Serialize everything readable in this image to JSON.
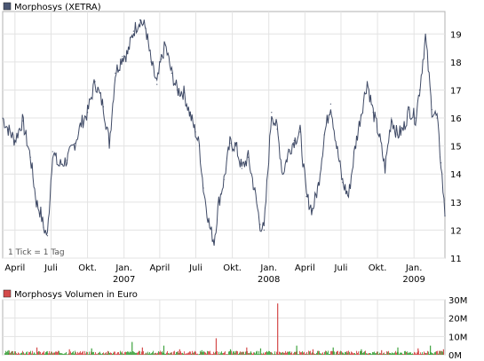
{
  "chart_data": [
    {
      "type": "line",
      "title": "Morphosys (XETRA)",
      "legend_color": "#4a5673",
      "line_color": "#3f4a66",
      "annotation": "1 Tick = 1 Tag",
      "ylim": [
        11,
        19.8
      ],
      "yticks": [
        11,
        12,
        13,
        14,
        15,
        16,
        17,
        18,
        19
      ],
      "grid": true,
      "x_tick_labels": [
        {
          "label": "April",
          "year": ""
        },
        {
          "label": "Juli",
          "year": ""
        },
        {
          "label": "Okt.",
          "year": ""
        },
        {
          "label": "Jan.",
          "year": "2007"
        },
        {
          "label": "April",
          "year": ""
        },
        {
          "label": "Juli",
          "year": ""
        },
        {
          "label": "Okt.",
          "year": ""
        },
        {
          "label": "Jan.",
          "year": "2008"
        },
        {
          "label": "April",
          "year": ""
        },
        {
          "label": "Juli",
          "year": ""
        },
        {
          "label": "Okt.",
          "year": ""
        },
        {
          "label": "Jan.",
          "year": "2009"
        }
      ],
      "x_range": [
        "2006-03-01",
        "2009-03-20"
      ],
      "x_ticks": [
        "2006-04-01",
        "2006-07-01",
        "2006-10-01",
        "2007-01-01",
        "2007-04-01",
        "2007-07-01",
        "2007-10-01",
        "2008-01-01",
        "2008-04-01",
        "2008-07-01",
        "2008-10-01",
        "2009-01-01"
      ],
      "series": [
        {
          "name": "Morphosys (XETRA)",
          "x": [
            "2006-03-01",
            "2006-03-15",
            "2006-04-01",
            "2006-04-20",
            "2006-05-10",
            "2006-05-25",
            "2006-06-05",
            "2006-06-12",
            "2006-06-22",
            "2006-07-05",
            "2006-07-20",
            "2006-08-10",
            "2006-08-30",
            "2006-09-15",
            "2006-10-01",
            "2006-10-20",
            "2006-11-10",
            "2006-11-25",
            "2006-12-10",
            "2006-12-28",
            "2007-01-10",
            "2007-01-25",
            "2007-02-10",
            "2007-02-25",
            "2007-03-10",
            "2007-03-25",
            "2007-04-05",
            "2007-04-15",
            "2007-05-01",
            "2007-05-15",
            "2007-06-01",
            "2007-06-15",
            "2007-06-30",
            "2007-07-10",
            "2007-07-20",
            "2007-08-05",
            "2007-08-16",
            "2007-08-28",
            "2007-09-10",
            "2007-09-25",
            "2007-10-10",
            "2007-10-25",
            "2007-11-10",
            "2007-11-25",
            "2007-12-10",
            "2007-12-20",
            "2008-01-08",
            "2008-01-22",
            "2008-02-05",
            "2008-02-20",
            "2008-03-05",
            "2008-03-20",
            "2008-04-05",
            "2008-04-20",
            "2008-05-05",
            "2008-05-20",
            "2008-06-05",
            "2008-06-20",
            "2008-07-05",
            "2008-07-20",
            "2008-08-05",
            "2008-08-20",
            "2008-09-05",
            "2008-09-20",
            "2008-10-05",
            "2008-10-20",
            "2008-11-05",
            "2008-11-20",
            "2008-12-05",
            "2008-12-20",
            "2009-01-05",
            "2009-01-15",
            "2009-01-30",
            "2009-02-15",
            "2009-02-28",
            "2009-03-10",
            "2009-03-20"
          ],
          "values": [
            16.0,
            15.6,
            15.2,
            15.9,
            14.6,
            13.0,
            12.6,
            12.1,
            11.8,
            14.8,
            14.3,
            14.5,
            15.1,
            15.8,
            16.2,
            17.3,
            16.4,
            15.1,
            17.6,
            18.2,
            18.3,
            19.1,
            19.5,
            19.2,
            18.0,
            17.2,
            18.1,
            18.6,
            17.6,
            17.0,
            16.9,
            16.2,
            15.5,
            15.0,
            13.5,
            12.1,
            11.6,
            13.0,
            13.8,
            15.1,
            15.0,
            14.2,
            14.6,
            13.5,
            12.2,
            12.0,
            16.2,
            15.6,
            14.0,
            14.8,
            15.2,
            15.5,
            13.2,
            12.7,
            13.6,
            15.4,
            16.5,
            15.0,
            13.7,
            13.2,
            14.9,
            16.1,
            17.3,
            16.2,
            15.4,
            14.2,
            16.0,
            15.4,
            15.6,
            16.3,
            16.0,
            17.0,
            18.9,
            16.3,
            16.0,
            14.4,
            12.5
          ]
        }
      ]
    },
    {
      "type": "bar",
      "title": "Morphosys Volumen in Euro",
      "legend_color": "#d44a4a",
      "ylim": [
        0,
        30000000
      ],
      "y_tick_labels": [
        "0M",
        "10M",
        "20M",
        "30M"
      ],
      "grid": true,
      "bar_colors": [
        "#3fa33f",
        "#d44a4a"
      ],
      "series": [
        {
          "name": "Morphosys Volumen in Euro",
          "x": [
            "2006-03-15",
            "2006-05-25",
            "2006-06-20",
            "2006-08-15",
            "2006-10-10",
            "2006-11-20",
            "2007-01-20",
            "2007-02-15",
            "2007-04-10",
            "2007-05-20",
            "2007-07-15",
            "2007-08-20",
            "2007-09-25",
            "2007-11-05",
            "2007-12-10",
            "2008-01-22",
            "2008-03-10",
            "2008-04-20",
            "2008-06-10",
            "2008-07-15",
            "2008-08-20",
            "2008-10-10",
            "2008-11-20",
            "2009-01-10",
            "2009-02-10",
            "2009-03-15"
          ],
          "values": [
            2500000,
            4000000,
            2000000,
            3000000,
            3500000,
            2000000,
            7000000,
            4000000,
            5000000,
            3000000,
            2500000,
            9000000,
            3000000,
            4000000,
            3500000,
            28000000,
            5000000,
            3000000,
            4000000,
            2000000,
            3000000,
            2500000,
            4000000,
            3500000,
            5000000,
            3000000
          ]
        }
      ]
    }
  ]
}
